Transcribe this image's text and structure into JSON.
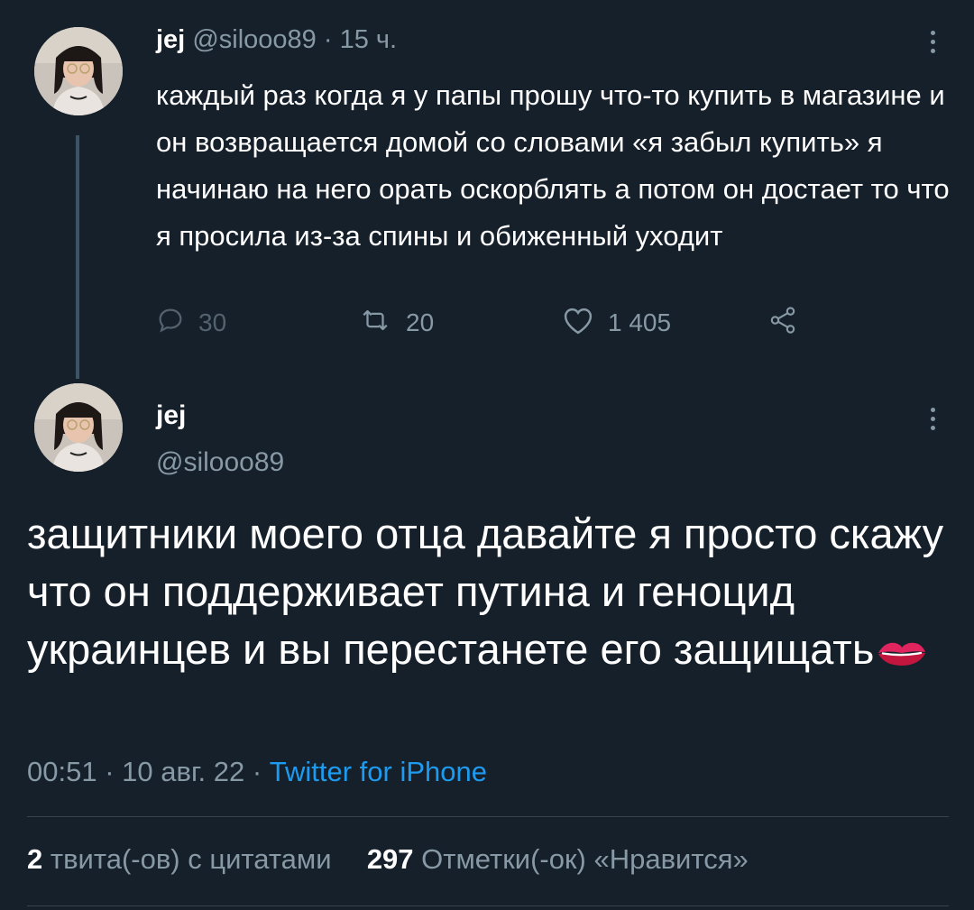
{
  "reply_tweet": {
    "name": "jej",
    "handle": "@silooo89",
    "separator": "·",
    "time": "15 ч.",
    "text": "каждый раз когда я у папы прошу что-то купить в магазине и он возвращается домой со словами «я забыл купить» я начинаю на него орать оскорблять а потом он достает то что я просила из-за спины и обиженный уходит",
    "actions": {
      "replies": "30",
      "retweets": "20",
      "likes": "1 405"
    },
    "icons": {
      "reply": "reply-icon",
      "retweet": "retweet-icon",
      "like": "heart-icon",
      "share": "share-icon",
      "more": "more-vertical-icon"
    }
  },
  "main_tweet": {
    "name": "jej",
    "handle": "@silooo89",
    "text": "защитники моего отца давайте я просто скажу что он поддерживает путина и геноцид украинцев и вы перестанете его защищать",
    "emoji": "kiss-mark-icon",
    "time": "00:51",
    "date": "10 авг. 22",
    "source": "Twitter for iPhone",
    "separator": "·",
    "stats": {
      "quotes_count": "2",
      "quotes_label": "твита(-ов) с цитатами",
      "likes_count": "297",
      "likes_label": "Отметки(-ок) «Нравится»"
    }
  },
  "colors": {
    "background": "#15202b",
    "text": "#ffffff",
    "muted": "#8899a6",
    "link": "#1d9bf0",
    "divider": "#38444d"
  }
}
